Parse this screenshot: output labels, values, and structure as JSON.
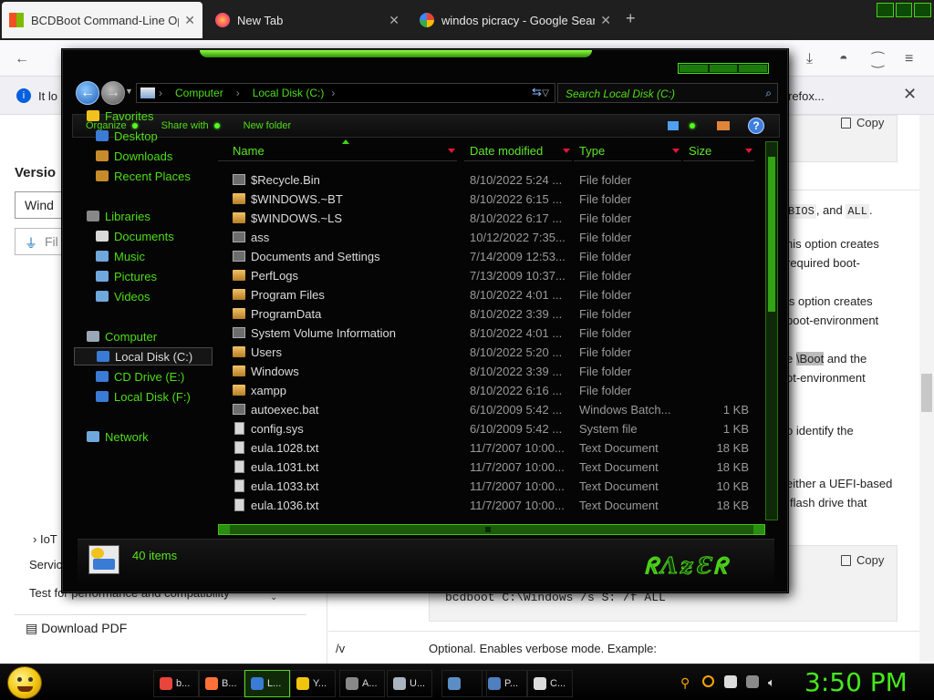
{
  "browser": {
    "tabs": [
      {
        "title": "BCDBoot Command-Line Optio",
        "active": true
      },
      {
        "title": "New Tab",
        "active": false
      },
      {
        "title": "windos picracy - Google Search",
        "active": false
      }
    ],
    "infobar": {
      "prefix": "It lo",
      "right_text": "refox..."
    }
  },
  "page": {
    "version_label": "Versio",
    "version_select": "Wind",
    "filter_placeholder": "Fil",
    "copy_label": "Copy",
    "right_lines": [
      {
        "text": "BIOS",
        "after": ", and",
        "code2": "ALL",
        "tail": "."
      },
      {
        "text": "his option creates"
      },
      {
        "text": "required boot-"
      },
      {
        "text": "is option creates"
      },
      {
        "text": "boot-environment"
      },
      {
        "pre": "e",
        "hl": "\\Boot",
        "text": " and the"
      },
      {
        "text": "ot-environment"
      },
      {
        "text": "o identify the"
      },
      {
        "text": "either a UEFI-based"
      },
      {
        "text": "flash drive that"
      }
    ],
    "left_items": [
      {
        "label": "IoT"
      },
      {
        "label": "Servic"
      },
      {
        "label": "Test for performance and compatibility"
      }
    ],
    "download_pdf": "Download PDF",
    "code_line": "bcdboot C:\\Windows /s S: /f ALL",
    "option_key": "/v",
    "option_desc": "Optional. Enables verbose mode. Example:"
  },
  "explorer": {
    "breadcrumb": [
      "Computer",
      "Local Disk (C:)"
    ],
    "search_placeholder": "Search Local Disk (C:)",
    "toolbar": {
      "organize": "Organize",
      "share_with": "Share with",
      "new_folder": "New folder"
    },
    "nav": [
      {
        "label": "Favorites",
        "indent": 0,
        "color": "#f1c21b"
      },
      {
        "label": "Desktop",
        "indent": 1,
        "color": "#3a7bd5"
      },
      {
        "label": "Downloads",
        "indent": 1,
        "color": "#c78b2a"
      },
      {
        "label": "Recent Places",
        "indent": 1,
        "color": "#c78b2a"
      },
      {
        "label": "Libraries",
        "indent": 0,
        "color": "#888888"
      },
      {
        "label": "Documents",
        "indent": 1,
        "color": "#d9d9d9"
      },
      {
        "label": "Music",
        "indent": 1,
        "color": "#6fa8dc"
      },
      {
        "label": "Pictures",
        "indent": 1,
        "color": "#6fa8dc"
      },
      {
        "label": "Videos",
        "indent": 1,
        "color": "#6fa8dc"
      },
      {
        "label": "Computer",
        "indent": 0,
        "color": "#9aa7b4"
      },
      {
        "label": "Local Disk (C:)",
        "indent": 1,
        "color": "#3a7bd5",
        "selected": true
      },
      {
        "label": "CD Drive (E:)",
        "indent": 1,
        "color": "#3a7bd5"
      },
      {
        "label": "Local Disk (F:)",
        "indent": 1,
        "color": "#3a7bd5"
      },
      {
        "label": "Network",
        "indent": 0,
        "color": "#6fa8dc"
      }
    ],
    "columns": [
      "Name",
      "Date modified",
      "Type",
      "Size"
    ],
    "files": [
      {
        "name": "$Recycle.Bin",
        "date": "8/10/2022 5:24 ...",
        "type": "File folder",
        "size": "",
        "icon": "sys"
      },
      {
        "name": "$WINDOWS.~BT",
        "date": "8/10/2022 6:15 ...",
        "type": "File folder",
        "size": "",
        "icon": "folder"
      },
      {
        "name": "$WINDOWS.~LS",
        "date": "8/10/2022 6:17 ...",
        "type": "File folder",
        "size": "",
        "icon": "folder"
      },
      {
        "name": "ass",
        "date": "10/12/2022 7:35...",
        "type": "File folder",
        "size": "",
        "icon": "sys"
      },
      {
        "name": "Documents and Settings",
        "date": "7/14/2009 12:53...",
        "type": "File folder",
        "size": "",
        "icon": "sys"
      },
      {
        "name": "PerfLogs",
        "date": "7/13/2009 10:37...",
        "type": "File folder",
        "size": "",
        "icon": "folder"
      },
      {
        "name": "Program Files",
        "date": "8/10/2022 4:01 ...",
        "type": "File folder",
        "size": "",
        "icon": "folder"
      },
      {
        "name": "ProgramData",
        "date": "8/10/2022 3:39 ...",
        "type": "File folder",
        "size": "",
        "icon": "folder"
      },
      {
        "name": "System Volume Information",
        "date": "8/10/2022 4:01 ...",
        "type": "File folder",
        "size": "",
        "icon": "sys"
      },
      {
        "name": "Users",
        "date": "8/10/2022 5:20 ...",
        "type": "File folder",
        "size": "",
        "icon": "folder"
      },
      {
        "name": "Windows",
        "date": "8/10/2022 3:39 ...",
        "type": "File folder",
        "size": "",
        "icon": "folder"
      },
      {
        "name": "xampp",
        "date": "8/10/2022 6:16 ...",
        "type": "File folder",
        "size": "",
        "icon": "folder"
      },
      {
        "name": "autoexec.bat",
        "date": "6/10/2009 5:42 ...",
        "type": "Windows Batch...",
        "size": "1 KB",
        "icon": "sys"
      },
      {
        "name": "config.sys",
        "date": "6/10/2009 5:42 ...",
        "type": "System file",
        "size": "1 KB",
        "icon": "file"
      },
      {
        "name": "eula.1028.txt",
        "date": "11/7/2007 10:00...",
        "type": "Text Document",
        "size": "18 KB",
        "icon": "file"
      },
      {
        "name": "eula.1031.txt",
        "date": "11/7/2007 10:00...",
        "type": "Text Document",
        "size": "18 KB",
        "icon": "file"
      },
      {
        "name": "eula.1033.txt",
        "date": "11/7/2007 10:00...",
        "type": "Text Document",
        "size": "10 KB",
        "icon": "file"
      },
      {
        "name": "eula.1036.txt",
        "date": "11/7/2007 10:00...",
        "type": "Text Document",
        "size": "18 KB",
        "icon": "file"
      }
    ],
    "item_count": "40 items",
    "logo_text": "RAZER"
  },
  "taskbar": {
    "buttons": [
      {
        "label": "b...",
        "color": "#e8453c"
      },
      {
        "label": "B...",
        "color": "#ff7139"
      },
      {
        "label": "L...",
        "color": "#3a7bd5",
        "active": true
      },
      {
        "label": "Y...",
        "color": "#f1c40f"
      },
      {
        "label": "A...",
        "color": "#888888"
      },
      {
        "label": "U...",
        "color": "#aab4bf"
      },
      {
        "label": "",
        "color": "#5c8ec6"
      },
      {
        "label": "P...",
        "color": "#4f7fbf"
      },
      {
        "label": "C...",
        "color": "#dddddd"
      }
    ],
    "clock": "3:50 PM"
  }
}
